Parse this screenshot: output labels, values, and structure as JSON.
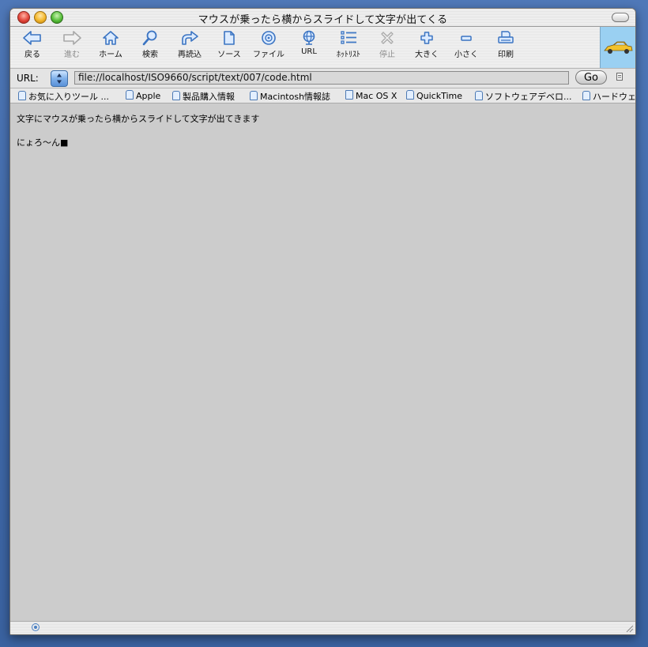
{
  "window": {
    "title": "マウスが乗ったら横からスライドして文字が出てくる"
  },
  "toolbar": {
    "items": [
      {
        "label": "戻る",
        "icon": "back-arrow-icon",
        "enabled": true
      },
      {
        "label": "進む",
        "icon": "forward-arrow-icon",
        "enabled": false
      },
      {
        "label": "ホーム",
        "icon": "home-icon",
        "enabled": true
      },
      {
        "label": "検索",
        "icon": "search-icon",
        "enabled": true
      },
      {
        "label": "再読込",
        "icon": "reload-icon",
        "enabled": true
      },
      {
        "label": "ソース",
        "icon": "source-document-icon",
        "enabled": true
      },
      {
        "label": "ファイル",
        "icon": "file-disc-icon",
        "enabled": true
      },
      {
        "label": "URL",
        "icon": "url-globe-icon",
        "enabled": true
      },
      {
        "label": "ﾎｯﾄﾘｽﾄ",
        "icon": "hotlist-icon",
        "enabled": true
      },
      {
        "label": "停止",
        "icon": "stop-icon",
        "enabled": false
      },
      {
        "label": "大きく",
        "icon": "plus-icon",
        "enabled": true
      },
      {
        "label": "小さく",
        "icon": "minus-icon",
        "enabled": true
      },
      {
        "label": "印刷",
        "icon": "print-icon",
        "enabled": true
      }
    ],
    "brand_icon": "car-logo-icon"
  },
  "address": {
    "label": "URL:",
    "value": "file://localhost/ISO9660/script/text/007/code.html",
    "go_label": "Go"
  },
  "bookmarks": [
    {
      "label": "お気に入りツール ..."
    },
    {
      "label": "Apple"
    },
    {
      "label": "製品購入情報"
    },
    {
      "label": "Macintosh情報誌"
    },
    {
      "label": "Mac OS X"
    },
    {
      "label": "QuickTime"
    },
    {
      "label": "ソフトウェアデベロ..."
    },
    {
      "label": "ハードウェ"
    }
  ],
  "content": {
    "line1": "文字にマウスが乗ったら横からスライドして文字が出てきます",
    "line2": "にょろ〜ん■"
  },
  "colors": {
    "desktop": "#4a73b4",
    "content_background": "#cccccc",
    "icon_blue": "#4a80c4"
  }
}
